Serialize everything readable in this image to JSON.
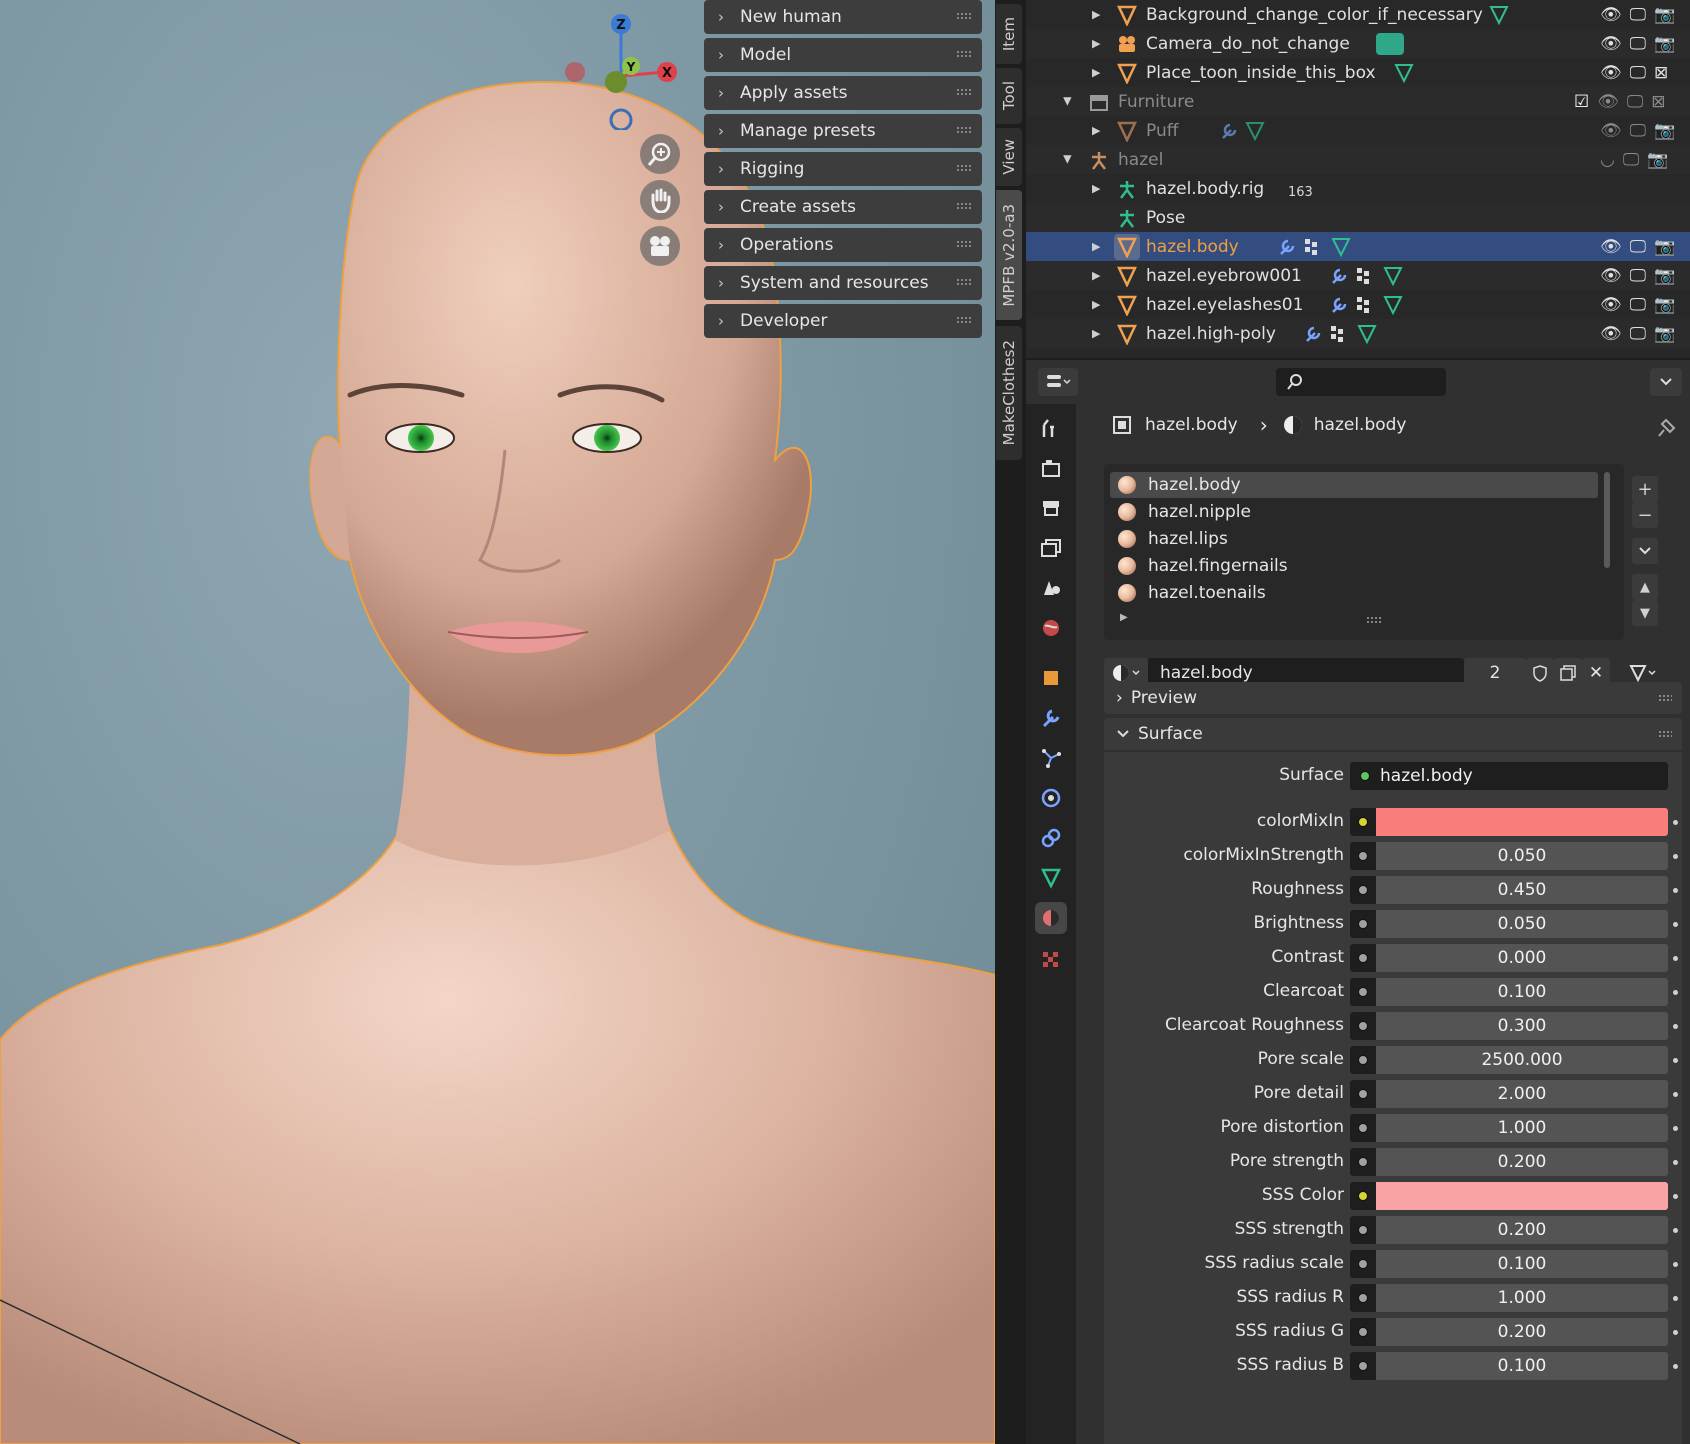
{
  "mpfb_menu": [
    {
      "label": "New human"
    },
    {
      "label": "Model"
    },
    {
      "label": "Apply assets"
    },
    {
      "label": "Manage presets"
    },
    {
      "label": "Rigging"
    },
    {
      "label": "Create assets"
    },
    {
      "label": "Operations"
    },
    {
      "label": "System and resources"
    },
    {
      "label": "Developer"
    }
  ],
  "vertical_tabs": [
    "Item",
    "Tool",
    "View",
    "MPFB v2.0-a3",
    "MakeClothes2"
  ],
  "gizmo": {
    "z": "Z",
    "y": "Y",
    "x": "X"
  },
  "outliner": {
    "rows": [
      {
        "label": "Background_change_color_if_necessary",
        "icon": "mesh-icon"
      },
      {
        "label": "Camera_do_not_change",
        "icon": "camera-icon"
      },
      {
        "label": "Place_toon_inside_this_box",
        "icon": "mesh-icon"
      },
      {
        "label": "Furniture",
        "icon": "collection-icon"
      },
      {
        "label": "Puff",
        "icon": "mesh-icon"
      },
      {
        "label": "hazel",
        "icon": "armature-icon"
      },
      {
        "label": "hazel.body.rig",
        "icon": "armature-icon",
        "count": "163"
      },
      {
        "label": "Pose",
        "icon": "pose-icon"
      },
      {
        "label": "hazel.body",
        "icon": "mesh-icon"
      },
      {
        "label": "hazel.eyebrow001",
        "icon": "mesh-icon"
      },
      {
        "label": "hazel.eyelashes01",
        "icon": "mesh-icon"
      },
      {
        "label": "hazel.high-poly",
        "icon": "mesh-icon"
      }
    ]
  },
  "properties": {
    "breadcrumb": {
      "object": "hazel.body",
      "material": "hazel.body"
    },
    "material_slots": [
      "hazel.body",
      "hazel.nipple",
      "hazel.lips",
      "hazel.fingernails",
      "hazel.toenails"
    ],
    "datablock": {
      "name": "hazel.body",
      "users": "2"
    },
    "panels": {
      "preview": "Preview",
      "surface": "Surface"
    },
    "surface_shader": {
      "label": "Surface",
      "value": "hazel.body"
    },
    "fields": [
      {
        "label": "colorMixIn",
        "type": "color",
        "color": "#f97d7b"
      },
      {
        "label": "colorMixInStrength",
        "value": "0.050"
      },
      {
        "label": "Roughness",
        "value": "0.450"
      },
      {
        "label": "Brightness",
        "value": "0.050"
      },
      {
        "label": "Contrast",
        "value": "0.000"
      },
      {
        "label": "Clearcoat",
        "value": "0.100"
      },
      {
        "label": "Clearcoat Roughness",
        "value": "0.300"
      },
      {
        "label": "Pore scale",
        "value": "2500.000"
      },
      {
        "label": "Pore detail",
        "value": "2.000"
      },
      {
        "label": "Pore distortion",
        "value": "1.000"
      },
      {
        "label": "Pore strength",
        "value": "0.200"
      },
      {
        "label": "SSS Color",
        "type": "color",
        "color": "#f9a4a4"
      },
      {
        "label": "SSS strength",
        "value": "0.200"
      },
      {
        "label": "SSS radius scale",
        "value": "0.100"
      },
      {
        "label": "SSS radius R",
        "value": "1.000"
      },
      {
        "label": "SSS radius G",
        "value": "0.200"
      },
      {
        "label": "SSS radius B",
        "value": "0.100"
      }
    ]
  },
  "colors": {
    "viewport_bg": "#7e98a4",
    "selection": "#334d80",
    "selected_text": "#f0a040",
    "outline": "#f0a040"
  }
}
